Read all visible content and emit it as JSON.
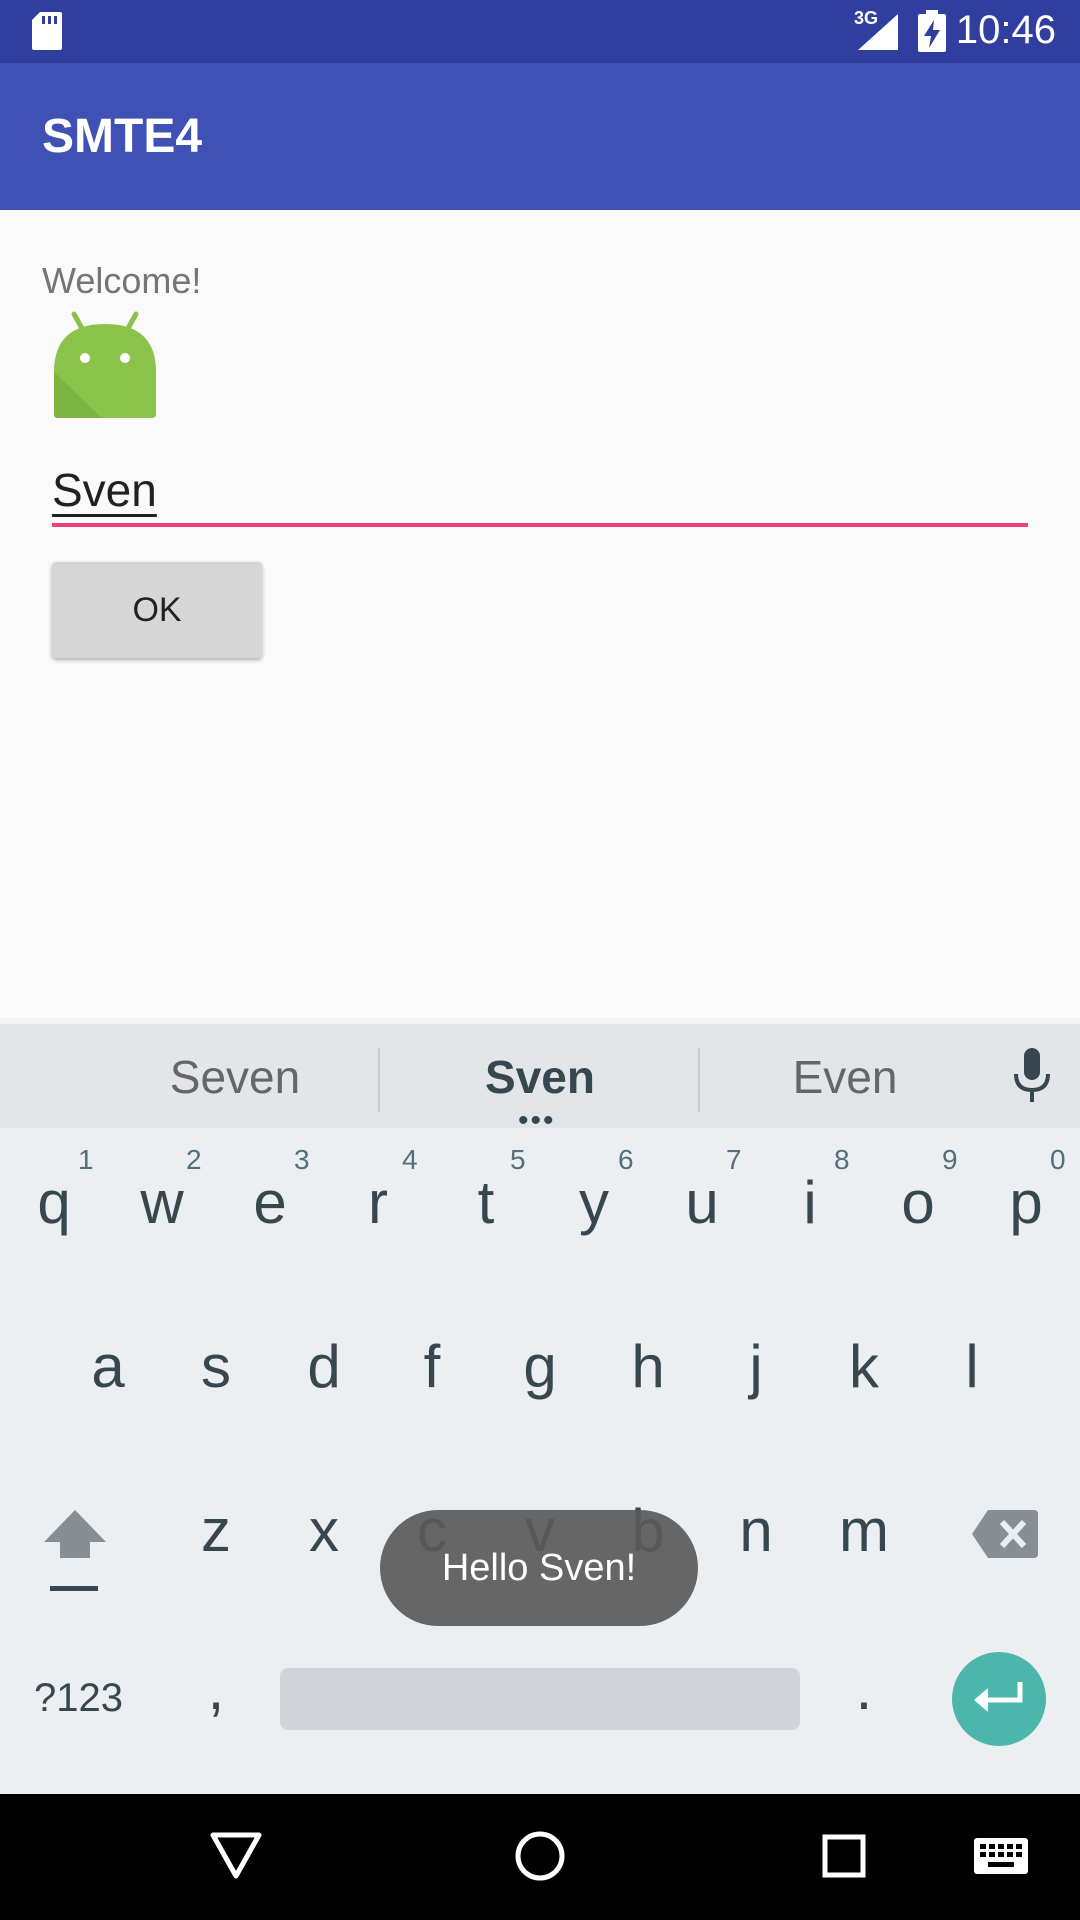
{
  "status_bar": {
    "time": "10:46",
    "network": "3G"
  },
  "app_bar": {
    "title": "SMTE4"
  },
  "main": {
    "welcome_text": "Welcome!",
    "name_input_value": "Sven",
    "ok_button_label": "OK"
  },
  "keyboard": {
    "suggestions": [
      "Seven",
      "Sven",
      "Even"
    ],
    "row1": [
      "q",
      "w",
      "e",
      "r",
      "t",
      "y",
      "u",
      "i",
      "o",
      "p"
    ],
    "row1_hints": [
      "1",
      "2",
      "3",
      "4",
      "5",
      "6",
      "7",
      "8",
      "9",
      "0"
    ],
    "row2": [
      "a",
      "s",
      "d",
      "f",
      "g",
      "h",
      "j",
      "k",
      "l"
    ],
    "row3": [
      "z",
      "x",
      "c",
      "v",
      "b",
      "n",
      "m"
    ],
    "symbols_label": "?123",
    "comma": ",",
    "period": "."
  },
  "toast": {
    "text": "Hello Sven!"
  },
  "colors": {
    "status_bar": "#303f9f",
    "app_bar": "#3f51b5",
    "accent": "#ec407a",
    "enter": "#4db6ac"
  }
}
